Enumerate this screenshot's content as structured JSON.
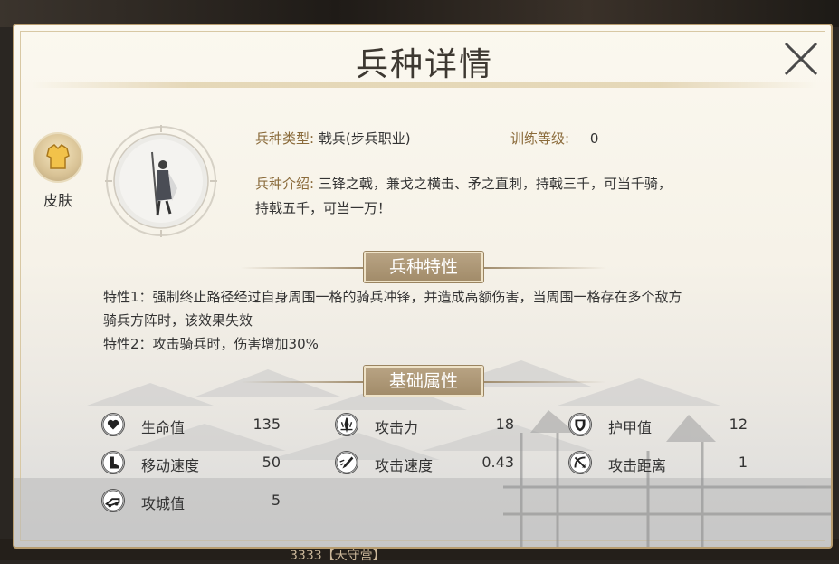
{
  "dialog": {
    "title": "兵种详情",
    "skin_label": "皮肤"
  },
  "unit": {
    "type_label": "兵种类型:",
    "type_value": "戟兵(步兵职业)",
    "training_label": "训练等级:",
    "training_value": "0",
    "intro_label": "兵种介绍:",
    "intro_line1": "三锋之戟，兼戈之横击、矛之直刺，持戟三千，可当千骑，",
    "intro_line2": "持戟五千，可当一万！"
  },
  "traits": {
    "header": "兵种特性",
    "line1": "特性1：强制终止路径经过自身周围一格的骑兵冲锋，并造成高额伤害，当周围一格存在多个敌方",
    "line2": "骑兵方阵时，该效果失效",
    "line3": "特性2：攻击骑兵时，伤害增加30%"
  },
  "attributes": {
    "header": "基础属性",
    "items": [
      {
        "name": "生命值",
        "value": "135",
        "icon": "heart-icon"
      },
      {
        "name": "攻击力",
        "value": "18",
        "icon": "attack-icon"
      },
      {
        "name": "护甲值",
        "value": "12",
        "icon": "shield-icon"
      },
      {
        "name": "移动速度",
        "value": "50",
        "icon": "boot-icon"
      },
      {
        "name": "攻击速度",
        "value": "0.43",
        "icon": "attack-speed-icon"
      },
      {
        "name": "攻击距离",
        "value": "1",
        "icon": "range-icon"
      },
      {
        "name": "攻城值",
        "value": "5",
        "icon": "siege-icon"
      }
    ]
  },
  "background": {
    "bottom_text": "3333【天守营】"
  },
  "colors": {
    "panel_border": "#b79c6f",
    "section_header_bg": "#a8926f",
    "label_brown": "#8a6a3a"
  }
}
